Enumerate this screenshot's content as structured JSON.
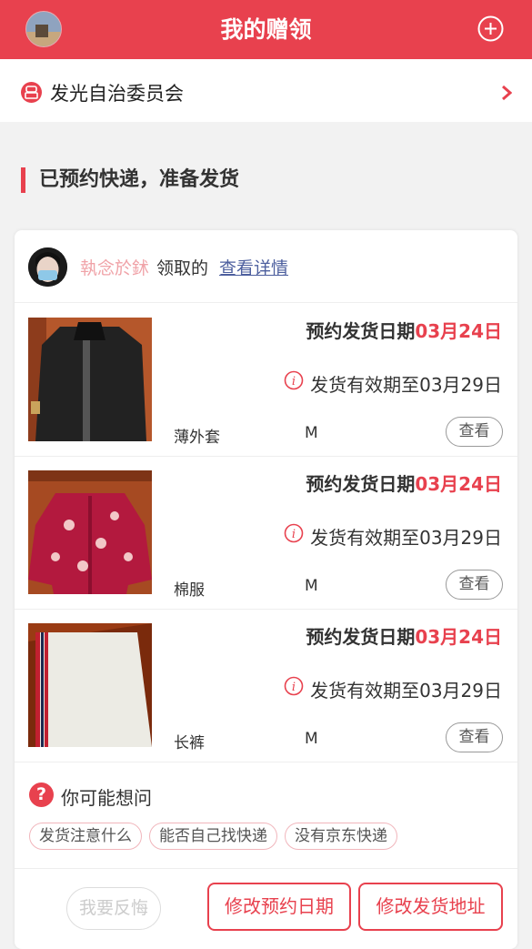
{
  "header": {
    "title": "我的赠领",
    "avatar_icon": "avatar-image",
    "add_icon": "plus-circle-icon"
  },
  "org": {
    "name": "发光自治委员会",
    "icon": "organization-icon",
    "arrow_icon": "chevron-right-icon"
  },
  "section": {
    "title": "已预约快递，准备发货"
  },
  "claim": {
    "user_name": "執念於鉥",
    "action_text": "领取的",
    "detail_link": "查看详情"
  },
  "items": [
    {
      "date_label": "预约发货日期",
      "date_value": "03月24日",
      "valid_text": "发货有效期至03月29日",
      "name": "薄外套",
      "size": "M",
      "view_label": "查看"
    },
    {
      "date_label": "预约发货日期",
      "date_value": "03月24日",
      "valid_text": "发货有效期至03月29日",
      "name": "棉服",
      "size": "M",
      "view_label": "查看"
    },
    {
      "date_label": "预约发货日期",
      "date_value": "03月24日",
      "valid_text": "发货有效期至03月29日",
      "name": "长裤",
      "size": "M",
      "view_label": "查看"
    }
  ],
  "faq": {
    "title": "你可能想问",
    "chips": [
      "发货注意什么",
      "能否自己找快递",
      "没有京东快递"
    ]
  },
  "actions": {
    "regret_label": "我要反悔",
    "change_date_label": "修改预约日期",
    "change_address_label": "修改发货地址"
  },
  "colors": {
    "brand": "#e8414e"
  }
}
